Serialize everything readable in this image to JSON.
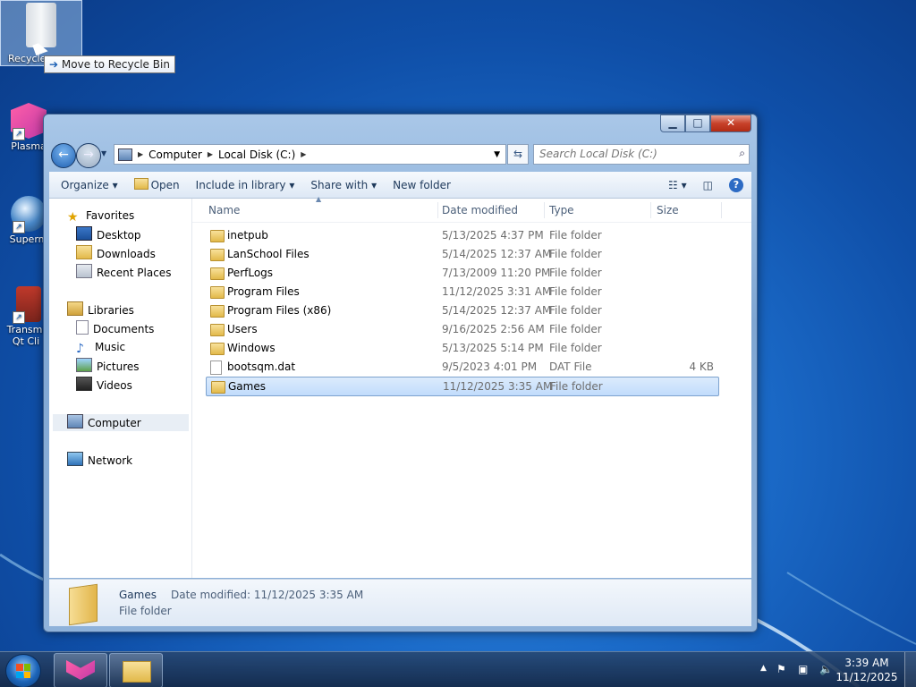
{
  "desktop": {
    "icons": [
      {
        "label": "Recycle"
      },
      {
        "label": "Plasma"
      },
      {
        "label": "Superm"
      },
      {
        "label": "Transmi Qt Cli"
      }
    ],
    "tooltip": "Move to Recycle Bin"
  },
  "window": {
    "caption_buttons": {
      "minimize": "▁",
      "maximize": "□",
      "close": "✕"
    },
    "address": {
      "segments": [
        "Computer",
        "Local Disk (C:)"
      ]
    },
    "search_placeholder": "Search Local Disk (C:)",
    "toolbar": {
      "organize": "Organize ▾",
      "open": "Open",
      "include_in_library": "Include in library ▾",
      "share_with": "Share with ▾",
      "new_folder": "New folder"
    },
    "nav": {
      "favorites": "Favorites",
      "desktop": "Desktop",
      "downloads": "Downloads",
      "recent_places": "Recent Places",
      "libraries": "Libraries",
      "documents": "Documents",
      "music": "Music",
      "pictures": "Pictures",
      "videos": "Videos",
      "computer": "Computer",
      "network": "Network"
    },
    "columns": {
      "name": "Name",
      "date_modified": "Date modified",
      "type": "Type",
      "size": "Size"
    },
    "files": [
      {
        "name": "inetpub",
        "date": "5/13/2025 4:37 PM",
        "type": "File folder",
        "size": "",
        "kind": "folder"
      },
      {
        "name": "LanSchool Files",
        "date": "5/14/2025 12:37 AM",
        "type": "File folder",
        "size": "",
        "kind": "folder"
      },
      {
        "name": "PerfLogs",
        "date": "7/13/2009 11:20 PM",
        "type": "File folder",
        "size": "",
        "kind": "folder"
      },
      {
        "name": "Program Files",
        "date": "11/12/2025 3:31 AM",
        "type": "File folder",
        "size": "",
        "kind": "folder"
      },
      {
        "name": "Program Files (x86)",
        "date": "5/14/2025 12:37 AM",
        "type": "File folder",
        "size": "",
        "kind": "folder"
      },
      {
        "name": "Users",
        "date": "9/16/2025 2:56 AM",
        "type": "File folder",
        "size": "",
        "kind": "folder"
      },
      {
        "name": "Windows",
        "date": "5/13/2025 5:14 PM",
        "type": "File folder",
        "size": "",
        "kind": "folder"
      },
      {
        "name": "bootsqm.dat",
        "date": "9/5/2023 4:01 PM",
        "type": "DAT File",
        "size": "4 KB",
        "kind": "file"
      },
      {
        "name": "Games",
        "date": "11/12/2025 3:35 AM",
        "type": "File folder",
        "size": "",
        "kind": "folder",
        "selected": true
      }
    ],
    "details": {
      "name": "Games",
      "modified": "Date modified: 11/12/2025 3:35 AM",
      "type": "File folder"
    }
  },
  "taskbar": {
    "clock_time": "3:39 AM",
    "clock_date": "11/12/2025"
  },
  "colors": {
    "selection": "#c1dcfc",
    "accent": "#1e395b"
  }
}
